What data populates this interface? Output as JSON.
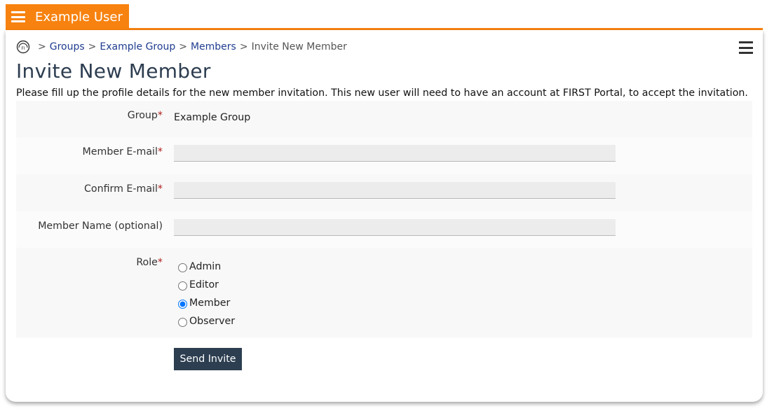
{
  "header": {
    "username": "Example User",
    "accent": "#f7820f"
  },
  "breadcrumb": {
    "home_icon": "home-logo-icon",
    "separator": ">",
    "items": [
      "Groups",
      "Example Group",
      "Members"
    ],
    "current": "Invite New Member"
  },
  "page": {
    "title": "Invite New Member",
    "intro": "Please fill up the profile details for the new member invitation. This new user will need to have an account at FIRST Portal, to accept the invitation."
  },
  "form": {
    "required_mark": "*",
    "group": {
      "label": "Group",
      "value": "Example Group"
    },
    "email": {
      "label": "Member E-mail",
      "value": ""
    },
    "confirm_email": {
      "label": "Confirm E-mail",
      "value": ""
    },
    "name": {
      "label": "Member Name (optional)",
      "value": ""
    },
    "role": {
      "label": "Role",
      "options": [
        "Admin",
        "Editor",
        "Member",
        "Observer"
      ],
      "selected": "Member"
    },
    "submit_label": "Send Invite"
  }
}
